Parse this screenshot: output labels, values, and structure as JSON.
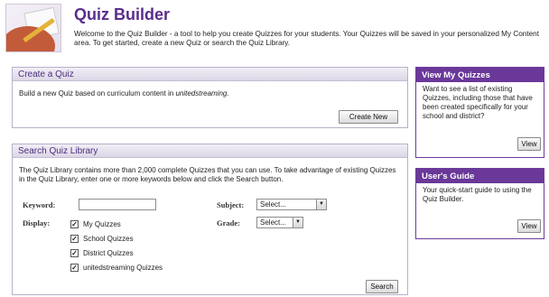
{
  "header": {
    "title": "Quiz Builder",
    "intro": "Welcome to the Quiz Builder - a tool to help you create Quizzes for your students. Your Quizzes will be saved in your personalized My Content area. To get started, create a new Quiz or search the Quiz Library."
  },
  "create": {
    "heading": "Create a Quiz",
    "desc_prefix": "Build a new Quiz based on curriculum content in ",
    "desc_em": "unitedstreaming.",
    "button": "Create New"
  },
  "search": {
    "heading": "Search Quiz Library",
    "desc": "The Quiz Library contains more than 2,000 complete Quizzes that you can use. To take advantage of existing Quizzes in the Quiz Library, enter one or more keywords below and click the Search button.",
    "keyword_label": "Keyword:",
    "keyword_value": "",
    "display_label": "Display:",
    "subject_label": "Subject:",
    "subject_value": "Select...",
    "grade_label": "Grade:",
    "grade_value": "Select...",
    "options": [
      {
        "label": "My Quizzes",
        "checked": true
      },
      {
        "label": "School Quizzes",
        "checked": true
      },
      {
        "label": "District Quizzes",
        "checked": true
      },
      {
        "label": "unitedstreaming Quizzes",
        "checked": true
      }
    ],
    "button": "Search"
  },
  "view_quizzes": {
    "heading": "View My Quizzes",
    "body": "Want to see a list of existing Quizzes, including those that have been created specifically for your school and district?",
    "button": "View"
  },
  "guide": {
    "heading": "User's Guide",
    "body": "Your quick-start guide to using the Quiz Builder.",
    "button": "View"
  },
  "icons": {
    "logo": "quiz-builder-logo",
    "check": "checkmark-icon",
    "dropdown": "chevron-down-icon"
  },
  "colors": {
    "brand_purple": "#5a2d8c",
    "side_header": "#6a3899"
  }
}
